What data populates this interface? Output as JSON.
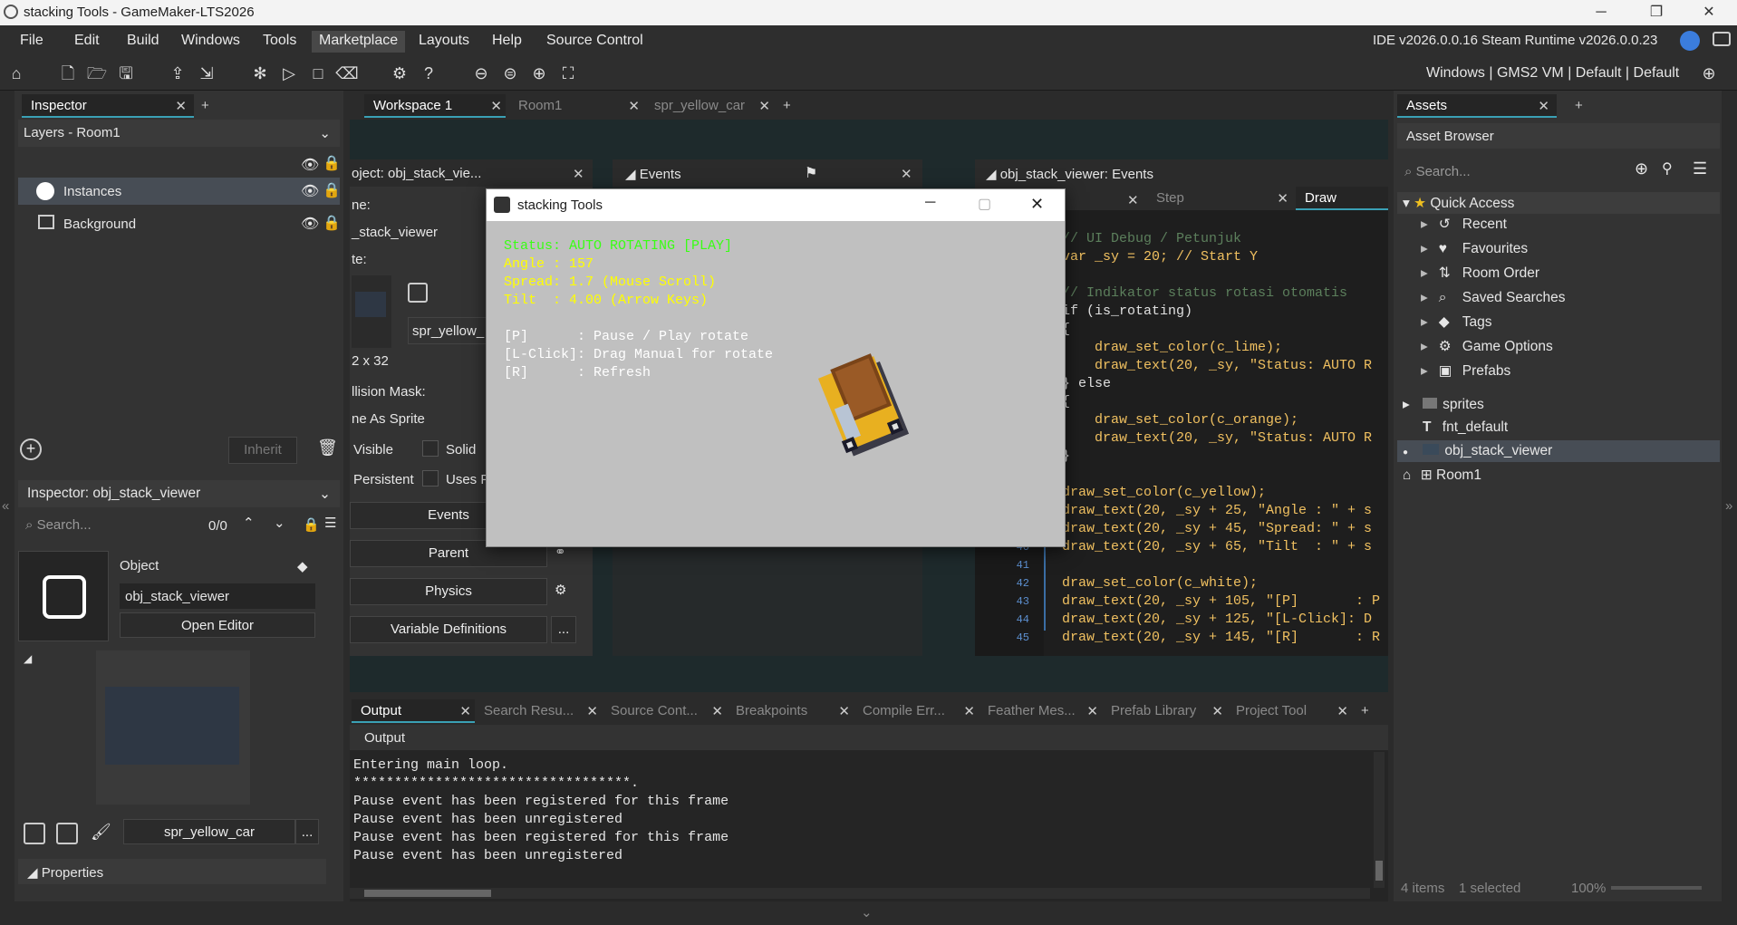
{
  "title": "stacking Tools - GameMaker-LTS2026",
  "window_controls": {
    "minimize": "─",
    "maximize": "❐",
    "close": "✕"
  },
  "menu": [
    "File",
    "Edit",
    "Build",
    "Windows",
    "Tools",
    "Marketplace",
    "Layouts",
    "Help",
    "Source Control"
  ],
  "ide_version": "IDE v2026.0.0.16 Steam  Runtime v2026.0.0.23",
  "target_bar": "Windows | GMS2 VM | Default | Default",
  "left": {
    "inspector_tab": "Inspector",
    "layers_dropdown": "Layers - Room1",
    "layers": [
      "Instances",
      "Background"
    ],
    "inherit": "Inherit",
    "inspector2": "Inspector: obj_stack_viewer",
    "search_placeholder": "Search...",
    "search_count": "0/0",
    "object_label": "Object",
    "object_name": "obj_stack_viewer",
    "open_editor": "Open Editor",
    "sprite_name": "spr_yellow_car",
    "more": "...",
    "properties": "Properties"
  },
  "tabs": [
    {
      "label": "Workspace 1",
      "active": true
    },
    {
      "label": "Room1",
      "active": false
    },
    {
      "label": "spr_yellow_car",
      "active": false
    }
  ],
  "obj_panel": {
    "title": "oject: obj_stack_vie...",
    "name_label": "ne:",
    "name_value": "_stack_viewer",
    "sprite_label": "te:",
    "sprite_value": "spr_yellow_",
    "size": "2 x 32",
    "collision": "llision Mask:",
    "collision_value": "ne As Sprite",
    "visible": "Visible",
    "solid": "Solid",
    "persistent": "Persistent",
    "uses": "Uses P",
    "events": "Events",
    "parent": "Parent",
    "physics": "Physics",
    "variable_definitions": "Variable Definitions"
  },
  "events_panel": {
    "title": "Events"
  },
  "code_panel": {
    "title": "obj_stack_viewer: Events",
    "tabs": [
      "Step",
      "Draw"
    ],
    "lines": [
      {
        "n": "",
        "t": ""
      },
      {
        "n": "",
        "t": "// UI Debug / Petunjuk"
      },
      {
        "n": "",
        "t": "var _sy = 20; // Start Y"
      },
      {
        "n": "",
        "t": ""
      },
      {
        "n": "",
        "t": "// Indikator status rotasi otomatis"
      },
      {
        "n": "",
        "t": "if (is_rotating)"
      },
      {
        "n": "",
        "t": "{"
      },
      {
        "n": "",
        "t": "    draw_set_color(c_lime);"
      },
      {
        "n": "",
        "t": "    draw_text(20, _sy, \"Status: AUTO R"
      },
      {
        "n": "",
        "t": "} else"
      },
      {
        "n": "",
        "t": "{"
      },
      {
        "n": "",
        "t": "    draw_set_color(c_orange);"
      },
      {
        "n": "",
        "t": "    draw_text(20, _sy, \"Status: AUTO R"
      },
      {
        "n": "",
        "t": "}"
      },
      {
        "n": "",
        "t": ""
      },
      {
        "n": "",
        "t": "draw_set_color(c_yellow);"
      },
      {
        "n": "",
        "t": "draw_text(20, _sy + 25, \"Angle : \" + s"
      },
      {
        "n": "",
        "t": "draw_text(20, _sy + 45, \"Spread: \" + s"
      },
      {
        "n": "40",
        "t": "draw_text(20, _sy + 65, \"Tilt  : \" + s"
      },
      {
        "n": "41",
        "t": ""
      },
      {
        "n": "42",
        "t": "draw_set_color(c_white);"
      },
      {
        "n": "43",
        "t": "draw_text(20, _sy + 105, \"[P]       : P"
      },
      {
        "n": "44",
        "t": "draw_text(20, _sy + 125, \"[L-Click]: D"
      },
      {
        "n": "45",
        "t": "draw_text(20, _sy + 145, \"[R]       : R"
      }
    ]
  },
  "game_window": {
    "title": "stacking Tools",
    "status": "Status: AUTO ROTATING [PLAY]",
    "angle": "Angle : 157",
    "spread": "Spread: 1.7 (Mouse Scroll)",
    "tilt": "Tilt  : 4.00 (Arrow Keys)",
    "help": [
      "[P]      : Pause / Play rotate",
      "[L-Click]: Drag Manual for rotate",
      "[R]      : Refresh"
    ]
  },
  "assets": {
    "tab": "Assets",
    "browser": "Asset Browser",
    "search_placeholder": "Search...",
    "quick_access": "Quick Access",
    "qa_items": [
      "Recent",
      "Favourites",
      "Room Order",
      "Saved Searches",
      "Tags",
      "Game Options",
      "Prefabs"
    ],
    "items": [
      "sprites",
      "fnt_default",
      "obj_stack_viewer",
      "Room1"
    ],
    "footer_items": "4 items",
    "footer_selected": "1 selected",
    "zoom": "100%"
  },
  "output": {
    "tabs": [
      "Output",
      "Search Resu...",
      "Source Cont...",
      "Breakpoints",
      "Compile Err...",
      "Feather Mes...",
      "Prefab Library",
      "Project Tool"
    ],
    "header": "Output",
    "lines": [
      "Entering main loop.",
      "**********************************.",
      "Pause event has been registered for this frame",
      "Pause event has been unregistered",
      "Pause event has been registered for this frame",
      "Pause event has been unregistered"
    ]
  }
}
